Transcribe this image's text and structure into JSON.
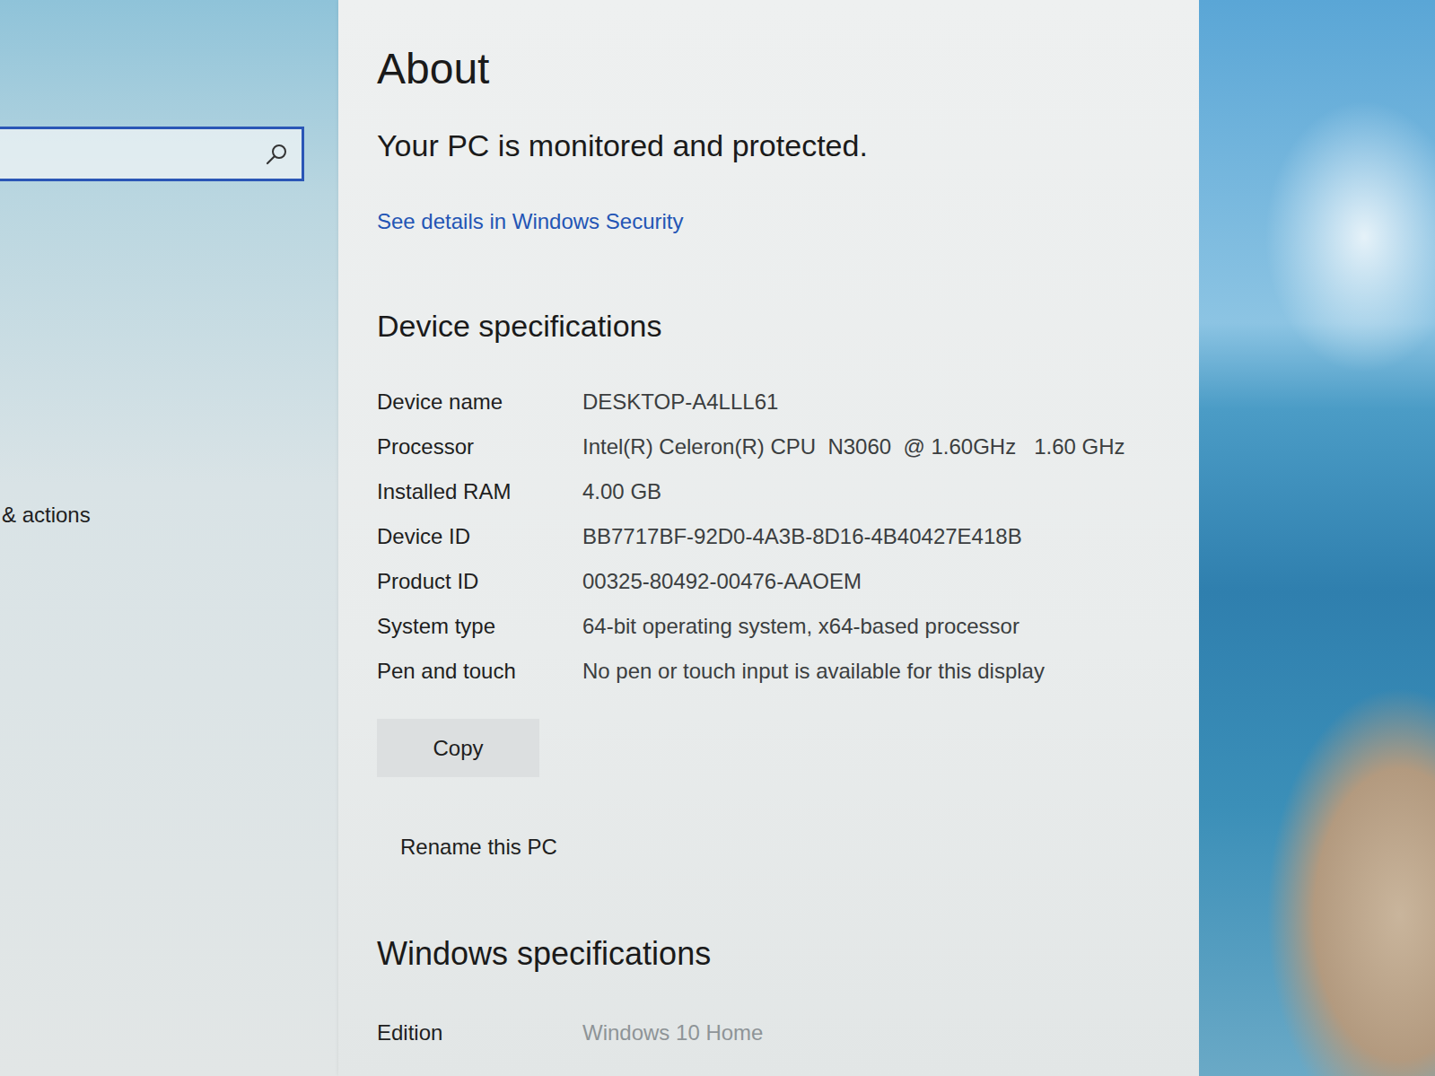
{
  "sidebar": {
    "items": [
      {
        "label": "& actions"
      }
    ]
  },
  "page": {
    "title": "About",
    "status": "Your PC is monitored and protected.",
    "security_link": "See details in Windows Security"
  },
  "device_specs": {
    "title": "Device specifications",
    "rows": [
      {
        "label": "Device name",
        "value": "DESKTOP-A4LLL61"
      },
      {
        "label": "Processor",
        "value": "Intel(R) Celeron(R) CPU  N3060  @ 1.60GHz   1.60 GHz"
      },
      {
        "label": "Installed RAM",
        "value": "4.00 GB"
      },
      {
        "label": "Device ID",
        "value": "BB7717BF-92D0-4A3B-8D16-4B40427E418B"
      },
      {
        "label": "Product ID",
        "value": "00325-80492-00476-AAOEM"
      },
      {
        "label": "System type",
        "value": "64-bit operating system, x64-based processor"
      },
      {
        "label": "Pen and touch",
        "value": "No pen or touch input is available for this display"
      }
    ],
    "buttons": [
      "Copy",
      "Rename this PC"
    ]
  },
  "windows_specs": {
    "title": "Windows specifications",
    "rows": [
      {
        "label": "Edition",
        "value": "Windows 10 Home"
      }
    ]
  }
}
